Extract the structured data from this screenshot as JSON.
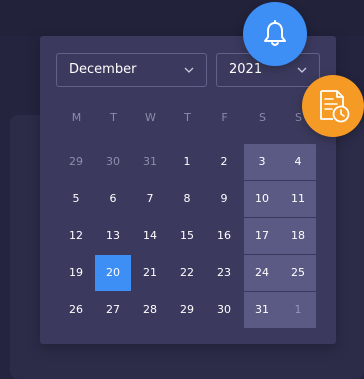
{
  "calendar": {
    "month_select": {
      "value": "December",
      "icon": "chevron-down-icon"
    },
    "year_select": {
      "value": "2021",
      "icon": "chevron-down-icon"
    },
    "weekdays": [
      "M",
      "T",
      "W",
      "T",
      "F",
      "S",
      "S"
    ],
    "weeks": [
      [
        {
          "label": "29",
          "muted": true
        },
        {
          "label": "30",
          "muted": true
        },
        {
          "label": "31",
          "muted": true
        },
        {
          "label": "1"
        },
        {
          "label": "2"
        },
        {
          "label": "3",
          "weekend": true
        },
        {
          "label": "4",
          "weekend": true
        }
      ],
      [
        {
          "label": "5"
        },
        {
          "label": "6"
        },
        {
          "label": "7"
        },
        {
          "label": "8"
        },
        {
          "label": "9"
        },
        {
          "label": "10",
          "weekend": true
        },
        {
          "label": "11",
          "weekend": true
        }
      ],
      [
        {
          "label": "12"
        },
        {
          "label": "13"
        },
        {
          "label": "14"
        },
        {
          "label": "15"
        },
        {
          "label": "16"
        },
        {
          "label": "17",
          "weekend": true
        },
        {
          "label": "18",
          "weekend": true
        }
      ],
      [
        {
          "label": "19"
        },
        {
          "label": "20",
          "selected": true
        },
        {
          "label": "21"
        },
        {
          "label": "22"
        },
        {
          "label": "23"
        },
        {
          "label": "24",
          "weekend": true
        },
        {
          "label": "25",
          "weekend": true
        }
      ],
      [
        {
          "label": "26"
        },
        {
          "label": "27"
        },
        {
          "label": "28"
        },
        {
          "label": "29"
        },
        {
          "label": "30"
        },
        {
          "label": "31",
          "weekend": true
        },
        {
          "label": "1",
          "weekend": true,
          "muted": true
        }
      ]
    ]
  },
  "floating_buttons": {
    "notification": {
      "icon": "bell-icon",
      "color": "#3d8ef5"
    },
    "report": {
      "icon": "report-clock-icon",
      "color": "#f59a24"
    }
  },
  "colors": {
    "background": "#24243f",
    "card": "#3b3a5e",
    "weekend_cell": "#5b5a85",
    "selected": "#3d8ef5",
    "accent_orange": "#f59a24"
  }
}
